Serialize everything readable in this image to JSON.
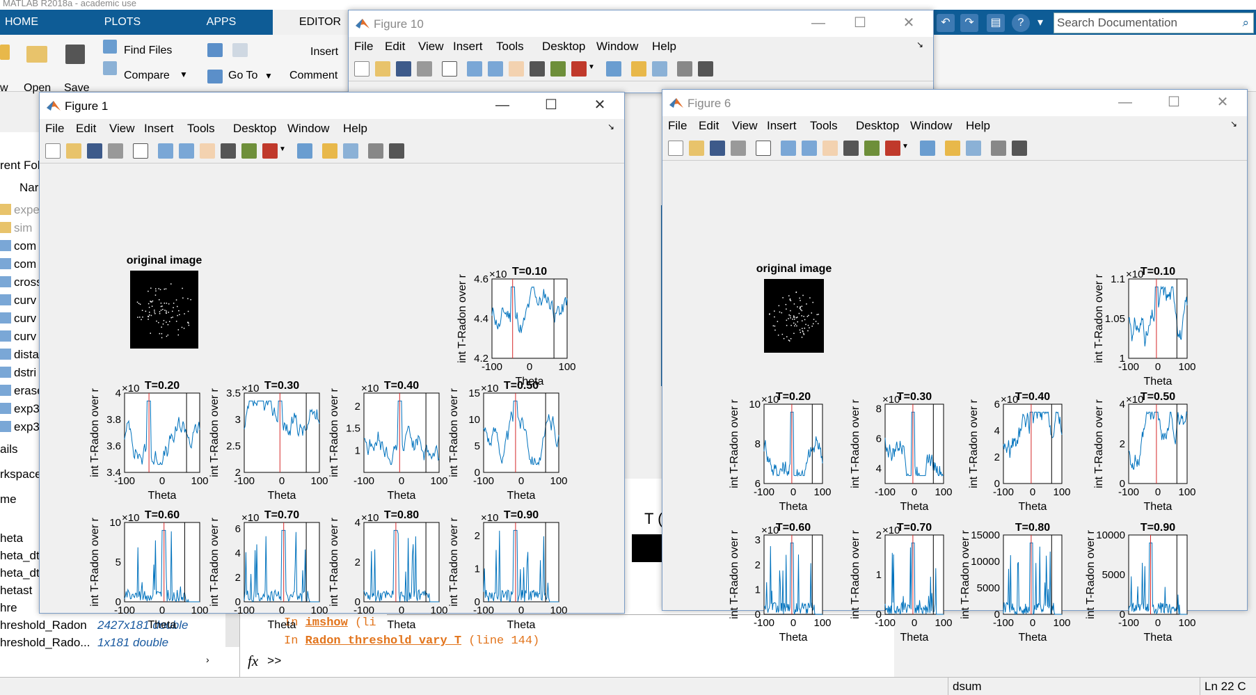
{
  "desktop": {
    "title": "MATLAB R2018a - academic use",
    "tabs": [
      {
        "label": "HOME"
      },
      {
        "label": "PLOTS"
      },
      {
        "label": "APPS"
      },
      {
        "label": "EDITOR"
      }
    ],
    "ribbon": {
      "find_files": "Find Files",
      "compare": "Compare",
      "go_to": "Go To",
      "insert": "Insert",
      "comment": "Comment",
      "open": "Open",
      "save": "Save",
      "new_partial": "w"
    },
    "search_placeholder": "Search Documentation",
    "current_folder_label": "rent Fol",
    "name_header": "Nar",
    "files": [
      "expe",
      "sim",
      "com",
      "com",
      "cross",
      "curv",
      "curv",
      "curv",
      "dista",
      "dstri",
      "erase",
      "exp3",
      "exp3"
    ],
    "details_label": "ails",
    "workspace_label": "rkspace",
    "ws_name_header": "me",
    "workspace_vars": [
      {
        "name": "heta",
        "value": ""
      },
      {
        "name": "heta_dt",
        "value": ""
      },
      {
        "name": "heta_dt",
        "value": ""
      },
      {
        "name": "hetast",
        "value": ""
      },
      {
        "name": "hre",
        "value": ""
      },
      {
        "name": "hreshold_Radon",
        "value": "2427x181 double"
      },
      {
        "name": "hreshold_Rado...",
        "value": "1x181 double"
      }
    ],
    "cmd_lines": [
      {
        "prefix": "In ",
        "func": "imshow",
        "rest": " (li"
      },
      {
        "prefix": "In ",
        "func": "Radon_threshold_vary_T",
        "rest": " (line 144)"
      }
    ],
    "prompt": ">>",
    "fx": "fx",
    "t_label": "T (%",
    "status_func": "dsum",
    "status_ln": "Ln",
    "status_ln_val": "22",
    "status_col": "C"
  },
  "figures": [
    {
      "id": "fig10",
      "title": "Figure 10",
      "menu": [
        "File",
        "Edit",
        "View",
        "Insert",
        "Tools",
        "Desktop",
        "Window",
        "Help"
      ]
    },
    {
      "id": "fig1",
      "title": "Figure 1",
      "menu": [
        "File",
        "Edit",
        "View",
        "Insert",
        "Tools",
        "Desktop",
        "Window",
        "Help"
      ],
      "original_label": "original image"
    },
    {
      "id": "fig6",
      "title": "Figure 6",
      "menu": [
        "File",
        "Edit",
        "View",
        "Insert",
        "Tools",
        "Desktop",
        "Window",
        "Help"
      ],
      "original_label": "original image"
    }
  ],
  "colors": {
    "line": "#0072bd",
    "redline": "#d62728",
    "blackline": "#000000",
    "title_blue": "#0e5c96"
  },
  "chart_data": [
    {
      "figure": "Figure 1",
      "type": "line",
      "title": "T=0.10",
      "xlabel": "Theta",
      "ylabel": "int T-Radon over r",
      "xlim": [
        -100,
        100
      ],
      "xticks": [
        -100,
        0,
        100
      ],
      "ylim": [
        4.2,
        4.6
      ],
      "yticks": [
        "4.2",
        "4.4",
        "4.6"
      ],
      "exponent": "×10",
      "red_x": -45,
      "black_x": 65
    },
    {
      "figure": "Figure 1",
      "type": "line",
      "title": "T=0.20",
      "xlabel": "Theta",
      "ylabel": "int T-Radon over r",
      "xlim": [
        -100,
        100
      ],
      "xticks": [
        -100,
        0,
        100
      ],
      "ylim": [
        3.4,
        4
      ],
      "yticks": [
        "3.4",
        "3.6",
        "3.8",
        "4"
      ],
      "exponent": "×10",
      "red_x": -35,
      "black_x": 65
    },
    {
      "figure": "Figure 1",
      "type": "line",
      "title": "T=0.30",
      "xlabel": "Theta",
      "ylabel": "int T-Radon over r",
      "xlim": [
        -100,
        100
      ],
      "xticks": [
        -100,
        0,
        100
      ],
      "ylim": [
        2,
        3.5
      ],
      "yticks": [
        "2",
        "2.5",
        "3",
        "3.5"
      ],
      "exponent": "×10",
      "red_x": -5,
      "black_x": 65
    },
    {
      "figure": "Figure 1",
      "type": "line",
      "title": "T=0.40",
      "xlabel": "Theta",
      "ylabel": "int T-Radon over r",
      "xlim": [
        -100,
        100
      ],
      "xticks": [
        -100,
        0,
        100
      ],
      "ylim": [
        0.5,
        2.3
      ],
      "yticks": [
        "1",
        "1.5",
        "2"
      ],
      "exponent": "×10",
      "red_x": -5,
      "black_x": 65
    },
    {
      "figure": "Figure 1",
      "type": "line",
      "title": "T=0.50",
      "xlabel": "Theta",
      "ylabel": "int T-Radon over r",
      "xlim": [
        -100,
        100
      ],
      "xticks": [
        -100,
        0,
        100
      ],
      "ylim": [
        0,
        15
      ],
      "yticks": [
        "0",
        "5",
        "10",
        "15"
      ],
      "exponent": "×10",
      "red_x": -15,
      "black_x": 65
    },
    {
      "figure": "Figure 1",
      "type": "line",
      "title": "T=0.60",
      "xlabel": "Theta",
      "ylabel": "int T-Radon over r",
      "xlim": [
        -100,
        100
      ],
      "xticks": [
        -100,
        0,
        100
      ],
      "ylim": [
        0,
        10
      ],
      "yticks": [
        "0",
        "5",
        "10"
      ],
      "exponent": "×10",
      "red_x": 5,
      "black_x": 60
    },
    {
      "figure": "Figure 1",
      "type": "line",
      "title": "T=0.70",
      "xlabel": "Theta",
      "ylabel": "int T-Radon over r",
      "xlim": [
        -100,
        100
      ],
      "xticks": [
        -100,
        0,
        100
      ],
      "ylim": [
        0,
        6.5
      ],
      "yticks": [
        "0",
        "2",
        "4",
        "6"
      ],
      "exponent": "×10",
      "red_x": 5,
      "black_x": 65
    },
    {
      "figure": "Figure 1",
      "type": "line",
      "title": "T=0.80",
      "xlabel": "Theta",
      "ylabel": "int T-Radon over r",
      "xlim": [
        -100,
        100
      ],
      "xticks": [
        -100,
        0,
        100
      ],
      "ylim": [
        0,
        4
      ],
      "yticks": [
        "0",
        "2",
        "4"
      ],
      "exponent": "×10",
      "red_x": -15,
      "black_x": 65
    },
    {
      "figure": "Figure 1",
      "type": "line",
      "title": "T=0.90",
      "xlabel": "Theta",
      "ylabel": "int T-Radon over r",
      "xlim": [
        -100,
        100
      ],
      "xticks": [
        -100,
        0,
        100
      ],
      "ylim": [
        0,
        2.4
      ],
      "yticks": [
        "0",
        "1",
        "2"
      ],
      "exponent": "×10",
      "red_x": -15,
      "black_x": 65
    },
    {
      "figure": "Figure 6",
      "type": "line",
      "title": "T=0.10",
      "xlabel": "Theta",
      "ylabel": "int T-Radon over r",
      "xlim": [
        -100,
        100
      ],
      "xticks": [
        -100,
        0,
        100
      ],
      "ylim": [
        1,
        1.1
      ],
      "yticks": [
        "1",
        "1.05",
        "1.1"
      ],
      "exponent": "×10",
      "red_x": -5,
      "black_x": 65
    },
    {
      "figure": "Figure 6",
      "type": "line",
      "title": "T=0.20",
      "xlabel": "Theta",
      "ylabel": "int T-Radon over r",
      "xlim": [
        -100,
        100
      ],
      "xticks": [
        -100,
        0,
        100
      ],
      "ylim": [
        6,
        10
      ],
      "yticks": [
        "6",
        "8",
        "10"
      ],
      "exponent": "×10",
      "red_x": -5,
      "black_x": 65
    },
    {
      "figure": "Figure 6",
      "type": "line",
      "title": "T=0.30",
      "xlabel": "Theta",
      "ylabel": "int T-Radon over r",
      "xlim": [
        -100,
        100
      ],
      "xticks": [
        -100,
        0,
        100
      ],
      "ylim": [
        3,
        8.3
      ],
      "yticks": [
        "4",
        "6",
        "8"
      ],
      "exponent": "×10",
      "red_x": -5,
      "black_x": 65
    },
    {
      "figure": "Figure 6",
      "type": "line",
      "title": "T=0.40",
      "xlabel": "Theta",
      "ylabel": "int T-Radon over r",
      "xlim": [
        -100,
        100
      ],
      "xticks": [
        -100,
        0,
        100
      ],
      "ylim": [
        0,
        6
      ],
      "yticks": [
        "0",
        "2",
        "4",
        "6"
      ],
      "exponent": "×10",
      "red_x": -5,
      "black_x": 65
    },
    {
      "figure": "Figure 6",
      "type": "line",
      "title": "T=0.50",
      "xlabel": "Theta",
      "ylabel": "int T-Radon over r",
      "xlim": [
        -100,
        100
      ],
      "xticks": [
        -100,
        0,
        100
      ],
      "ylim": [
        0,
        4
      ],
      "yticks": [
        "0",
        "2",
        "4"
      ],
      "exponent": "×10",
      "red_x": -5,
      "black_x": 65
    },
    {
      "figure": "Figure 6",
      "type": "line",
      "title": "T=0.60",
      "xlabel": "Theta",
      "ylabel": "int T-Radon over r",
      "xlim": [
        -100,
        100
      ],
      "xticks": [
        -100,
        0,
        100
      ],
      "ylim": [
        0,
        3.2
      ],
      "yticks": [
        "0",
        "1",
        "2",
        "3"
      ],
      "exponent": "×10",
      "red_x": -5,
      "black_x": 65
    },
    {
      "figure": "Figure 6",
      "type": "line",
      "title": "T=0.70",
      "xlabel": "Theta",
      "ylabel": "int T-Radon over r",
      "xlim": [
        -100,
        100
      ],
      "xticks": [
        -100,
        0,
        100
      ],
      "ylim": [
        0,
        2
      ],
      "yticks": [
        "0",
        "1",
        "2"
      ],
      "exponent": "×10",
      "red_x": -5,
      "black_x": 65
    },
    {
      "figure": "Figure 6",
      "type": "line",
      "title": "T=0.80",
      "xlabel": "Theta",
      "ylabel": "int T-Radon over r",
      "xlim": [
        -100,
        100
      ],
      "xticks": [
        -100,
        0,
        100
      ],
      "ylim": [
        0,
        15000
      ],
      "yticks": [
        "0",
        "5000",
        "10000",
        "15000"
      ],
      "exponent": "",
      "red_x": -5,
      "black_x": 65
    },
    {
      "figure": "Figure 6",
      "type": "line",
      "title": "T=0.90",
      "xlabel": "Theta",
      "ylabel": "int T-Radon over r",
      "xlim": [
        -100,
        100
      ],
      "xticks": [
        -100,
        0,
        100
      ],
      "ylim": [
        0,
        10000
      ],
      "yticks": [
        "0",
        "5000",
        "10000"
      ],
      "exponent": "",
      "red_x": -25,
      "black_x": 65
    }
  ]
}
